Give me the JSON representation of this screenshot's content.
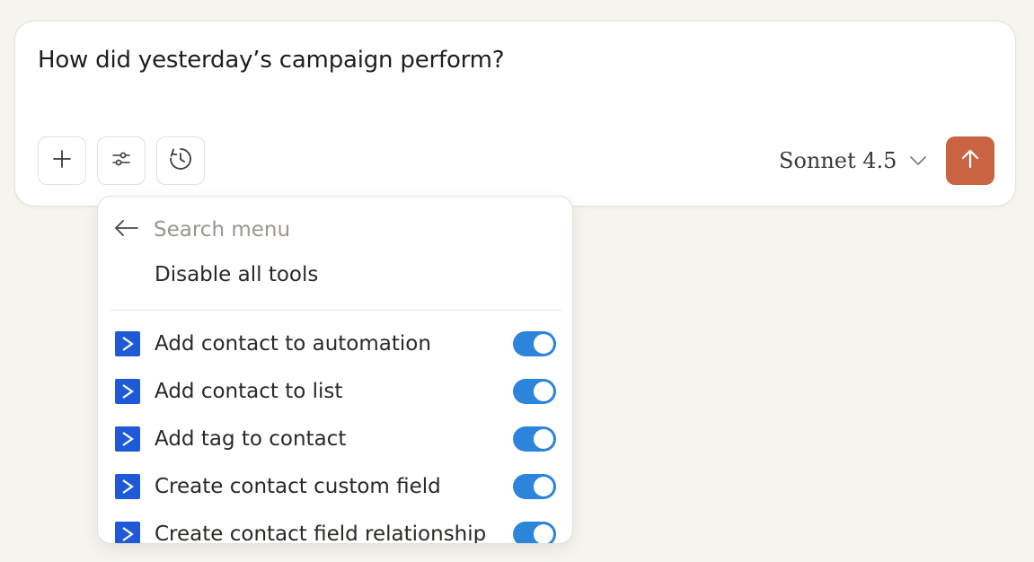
{
  "composer": {
    "prompt": "How did yesterday’s campaign perform?",
    "add_icon": "plus-icon",
    "tools_icon": "sliders-icon",
    "history_icon": "clock-history-icon",
    "model": "Sonnet 4.5",
    "send_icon": "arrow-up-icon",
    "accent": "#c96442"
  },
  "menu": {
    "search_placeholder": "Search menu",
    "back_icon": "arrow-left-icon",
    "disable_all_label": "Disable all tools",
    "tools": [
      {
        "label": "Add contact to automation",
        "enabled": true
      },
      {
        "label": "Add contact to list",
        "enabled": true
      },
      {
        "label": "Add tag to contact",
        "enabled": true
      },
      {
        "label": "Create contact custom field",
        "enabled": true
      },
      {
        "label": "Create contact field relationship",
        "enabled": true
      }
    ],
    "tool_logo_color": "#1e5ad8",
    "toggle_on_color": "#2c84db"
  }
}
